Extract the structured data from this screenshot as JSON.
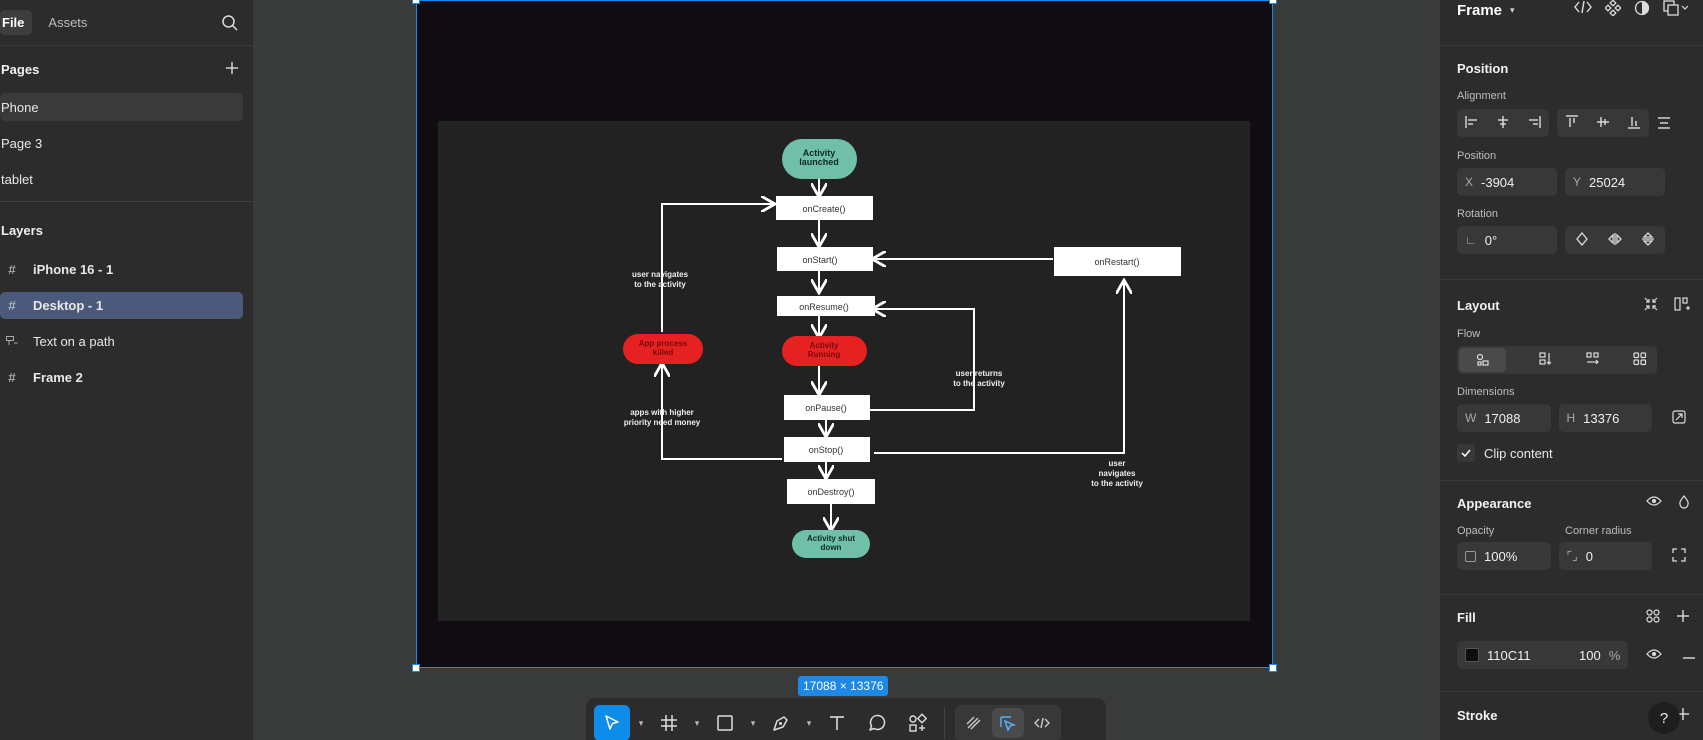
{
  "left_panel": {
    "tabs": {
      "file": "File",
      "assets": "Assets"
    },
    "pages_title": "Pages",
    "pages": [
      "Phone",
      "Page 3",
      "tablet"
    ],
    "layers_title": "Layers",
    "layers": [
      {
        "name": "iPhone 16 - 1",
        "icon": "frame-hash-icon"
      },
      {
        "name": "Desktop - 1",
        "icon": "frame-hash-icon"
      },
      {
        "name": "Text on a path",
        "icon": "text-path-icon"
      },
      {
        "name": "Frame 2",
        "icon": "frame-hash-icon"
      }
    ]
  },
  "canvas": {
    "frame_fill": "#110C11",
    "dimension_badge": "17088 × 13376",
    "diagram": {
      "nodes": {
        "launched": "Activity launched",
        "oncreate": "onCreate()",
        "onstart": "onStart()",
        "onrestart": "onRestart()",
        "onresume": "onResume()",
        "running": "Activity Running",
        "killed": "App process killed",
        "onpause": "onPause()",
        "onstop": "onStop()",
        "ondestroy": "onDestroy()",
        "shutdown": "Activity shut down"
      },
      "labels": {
        "navigates1": [
          "user navigates",
          "to the activity"
        ],
        "returns": [
          "user returns",
          "to the activity"
        ],
        "higher": [
          "apps with higher",
          "priority need money"
        ],
        "navigates2": [
          "user",
          "navigates",
          "to the activity"
        ]
      }
    }
  },
  "toolbar": {
    "tools": [
      "move-tool",
      "frame-tool",
      "shape-tool",
      "pen-tool",
      "text-tool",
      "comment-tool",
      "actions-tool"
    ],
    "modes": [
      "draw-mode",
      "design-mode",
      "dev-mode"
    ]
  },
  "right_panel": {
    "title": "Frame",
    "position": {
      "title": "Position",
      "alignment_label": "Alignment",
      "position_label": "Position",
      "x_prefix": "X",
      "x": "-3904",
      "y_prefix": "Y",
      "y": "25024",
      "rotation_label": "Rotation",
      "rotation": "0°"
    },
    "layout": {
      "title": "Layout",
      "flow_label": "Flow",
      "dimensions_label": "Dimensions",
      "w_prefix": "W",
      "w": "17088",
      "h_prefix": "H",
      "h": "13376",
      "clip_label": "Clip content",
      "clip_checked": true
    },
    "appearance": {
      "title": "Appearance",
      "opacity_label": "Opacity",
      "opacity": "100%",
      "radius_label": "Corner radius",
      "radius": "0"
    },
    "fill": {
      "title": "Fill",
      "hex": "110C11",
      "opacity": "100",
      "percent": "%",
      "swatch": "#110C11"
    },
    "stroke": {
      "title": "Stroke"
    },
    "help": "?"
  }
}
